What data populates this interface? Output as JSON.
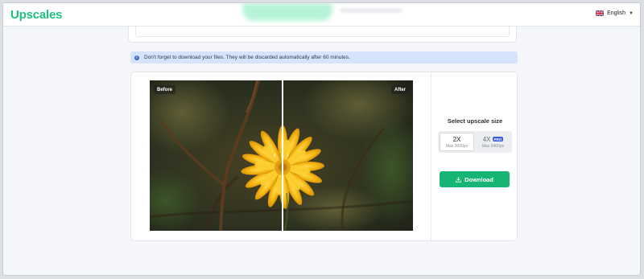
{
  "header": {
    "logo": "Upscales",
    "language": "English"
  },
  "notice": {
    "text": "Don't forget to download your files. They will be discarded automatically after 60 minutes."
  },
  "preview": {
    "before_label": "Before",
    "after_label": "After",
    "slider_position": 0.5
  },
  "upscale": {
    "title": "Select upscale size",
    "options": [
      {
        "label": "2X",
        "sub": "Max 3000px",
        "selected": true
      },
      {
        "label": "4X",
        "badge": "PRO",
        "sub": "Max 6400px",
        "selected": false
      }
    ],
    "download_label": "Download"
  },
  "colors": {
    "brand_green": "#1fbf7d",
    "download_green": "#16b573",
    "notice_bg": "#d5e3fb",
    "pro_blue": "#3b5bdb"
  }
}
